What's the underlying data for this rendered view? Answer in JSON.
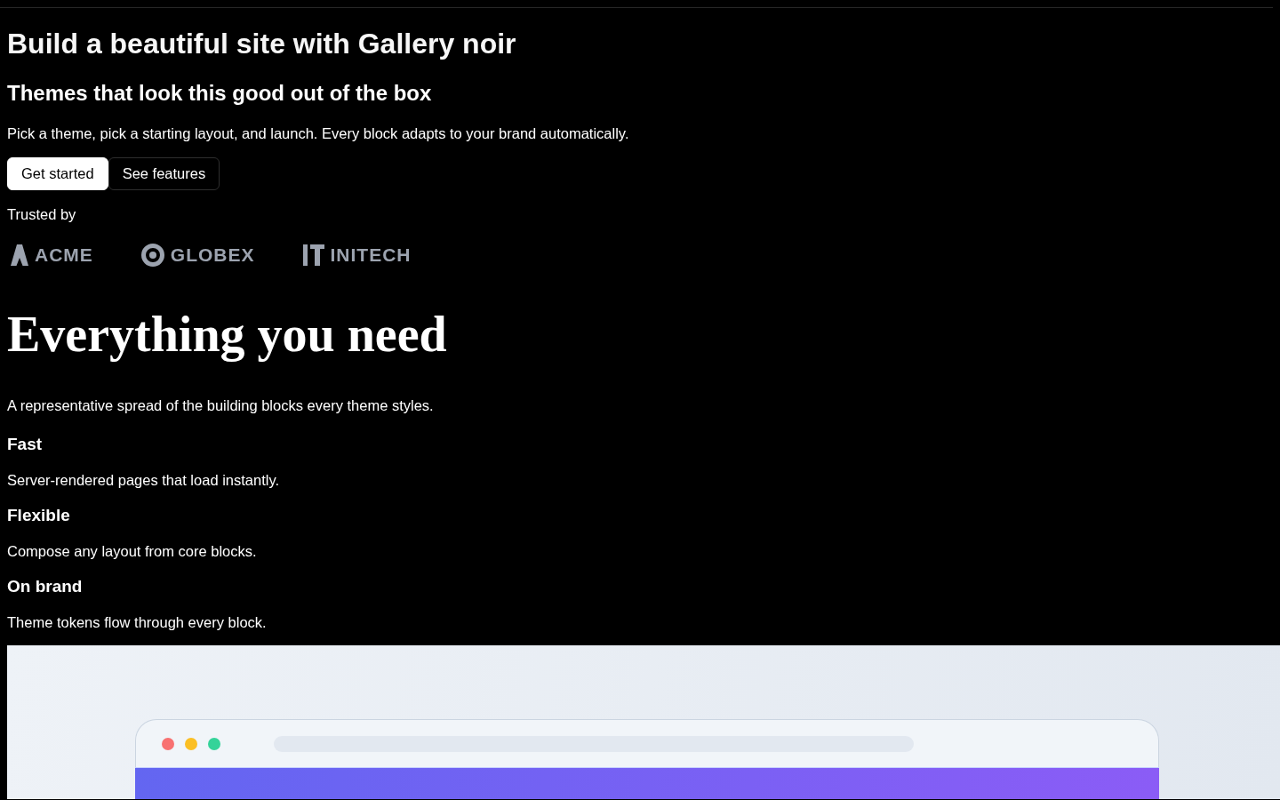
{
  "hero": {
    "title": "Build a beautiful site with Gallery noir",
    "subtitle": "Themes that look this good out of the box",
    "description": "Pick a theme, pick a starting layout, and launch. Every block adapts to your brand automatically.",
    "buttons": [
      {
        "label": "Get started",
        "kind": "primary"
      },
      {
        "label": "See features",
        "kind": "secondary"
      }
    ]
  },
  "trusted": {
    "label": "Trusted by",
    "logos": [
      {
        "name": "ACME",
        "kind": "peak"
      },
      {
        "name": "GLOBEX",
        "kind": "ring"
      },
      {
        "name": "INITECH",
        "kind": "bars"
      }
    ]
  },
  "features": {
    "title": "Everything you need",
    "description": "A representative spread of the building blocks every theme styles.",
    "items": [
      {
        "title": "Fast",
        "description": "Server-rendered pages that load instantly."
      },
      {
        "title": "Flexible",
        "description": "Compose any layout from core blocks."
      },
      {
        "title": "On brand",
        "description": "Theme tokens flow through every block."
      }
    ]
  },
  "preview": {
    "window_dots": [
      {
        "color": "#f87171"
      },
      {
        "color": "#fbbf24"
      },
      {
        "color": "#34d399"
      }
    ]
  }
}
